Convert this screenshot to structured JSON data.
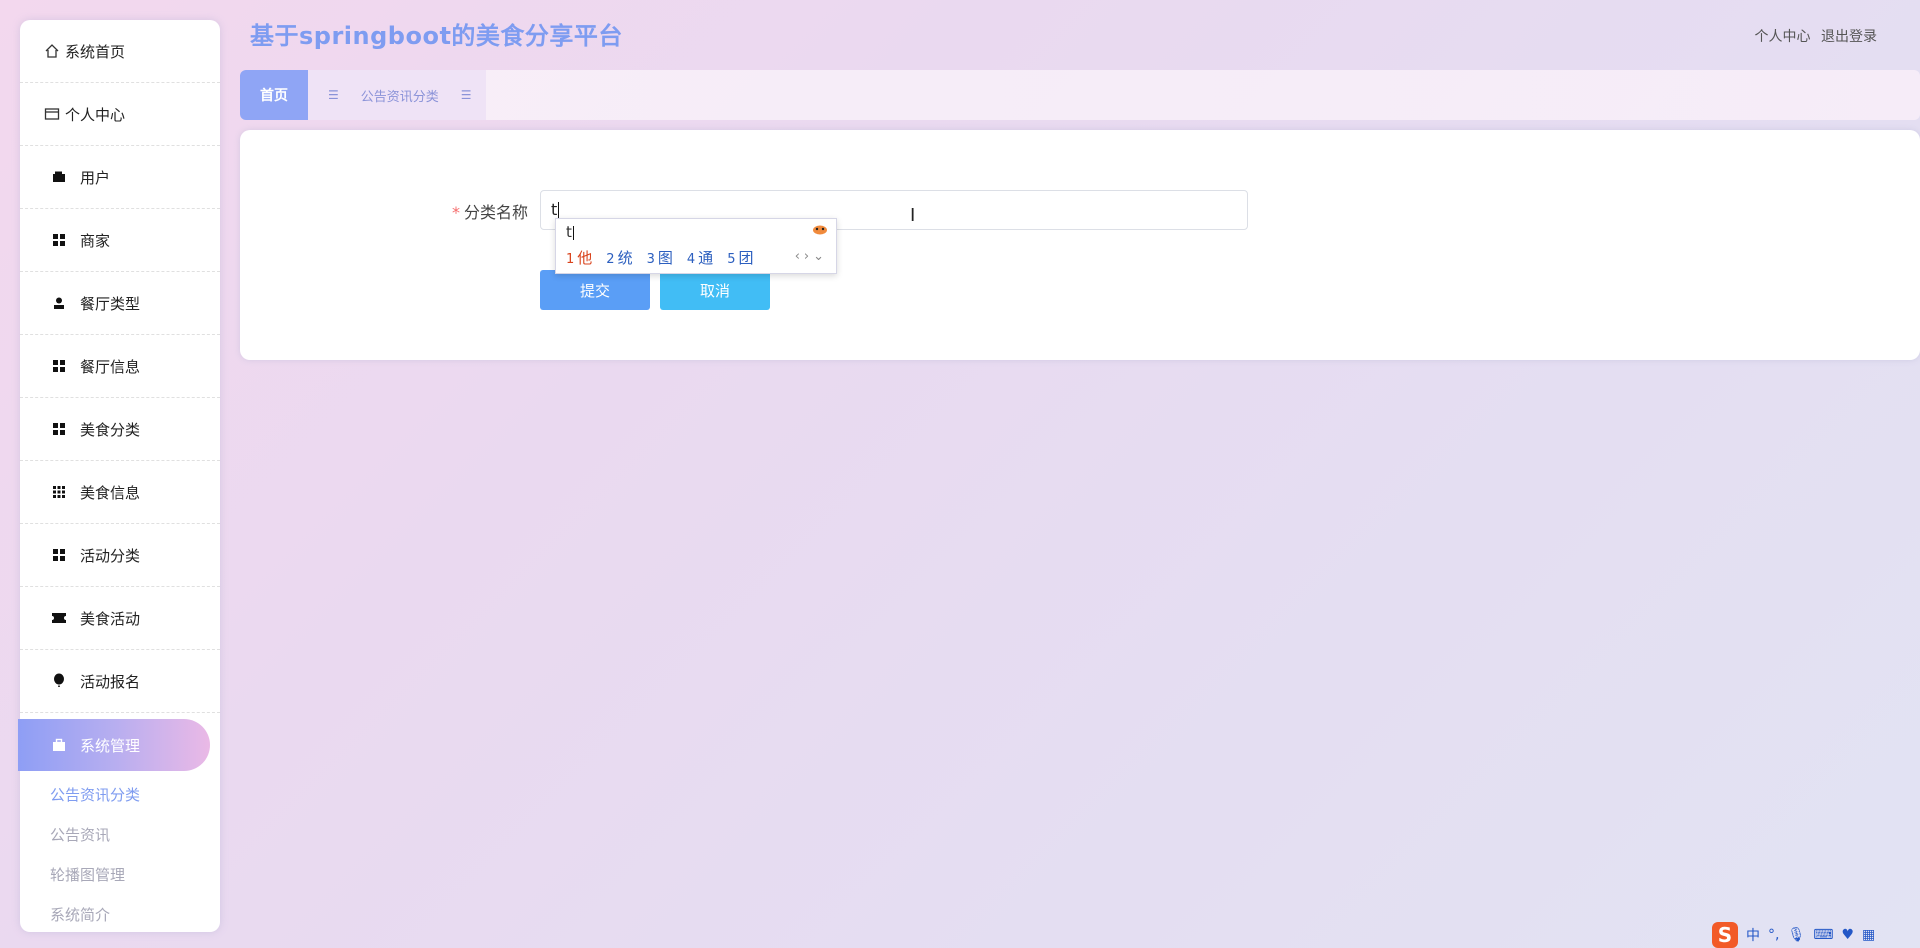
{
  "app": {
    "title": "基于springboot的美食分享平台"
  },
  "header": {
    "profile_link": "个人中心",
    "logout_link": "退出登录"
  },
  "sidebar": {
    "items": [
      {
        "label": "系统首页",
        "icon": "home-icon"
      },
      {
        "label": "个人中心",
        "icon": "id-card-icon"
      },
      {
        "label": "用户",
        "icon": "wallet-icon"
      },
      {
        "label": "商家",
        "icon": "grid-icon"
      },
      {
        "label": "餐厅类型",
        "icon": "user-icon"
      },
      {
        "label": "餐厅信息",
        "icon": "grid-icon"
      },
      {
        "label": "美食分类",
        "icon": "grid-icon"
      },
      {
        "label": "美食信息",
        "icon": "grid-nine-icon"
      },
      {
        "label": "活动分类",
        "icon": "grid-icon"
      },
      {
        "label": "美食活动",
        "icon": "ticket-icon"
      },
      {
        "label": "活动报名",
        "icon": "balloon-icon"
      },
      {
        "label": "系统管理",
        "icon": "briefcase-icon"
      }
    ],
    "submenu": [
      "公告资讯分类",
      "公告资讯",
      "轮播图管理",
      "系统简介"
    ]
  },
  "tabs": {
    "home": "首页",
    "current": "公告资讯分类"
  },
  "form": {
    "label": "分类名称",
    "required_mark": "*",
    "value": "t",
    "submit": "提交",
    "cancel": "取消"
  },
  "ime": {
    "composition": "t",
    "candidates": [
      {
        "n": "1",
        "text": "他"
      },
      {
        "n": "2",
        "text": "统"
      },
      {
        "n": "3",
        "text": "图"
      },
      {
        "n": "4",
        "text": "通"
      },
      {
        "n": "5",
        "text": "团"
      }
    ]
  },
  "tray": {
    "ime_mode": "中",
    "logo": "S"
  },
  "colors": {
    "accent": "#7e9cf1",
    "submit": "#5a9ef6",
    "cancel": "#41bdf5",
    "required": "#f56c6c"
  }
}
